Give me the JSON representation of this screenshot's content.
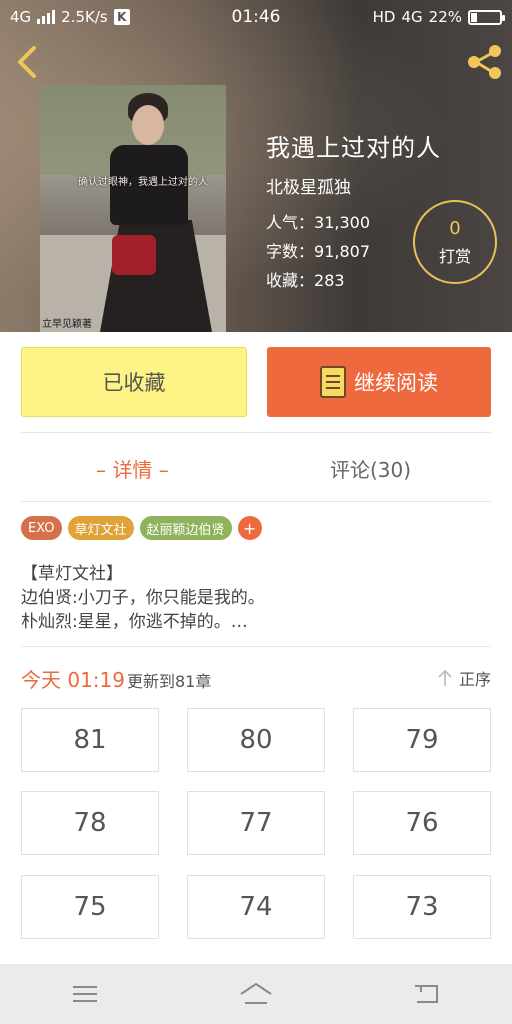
{
  "status_bar": {
    "network": "4G",
    "speed": "2.5K/s",
    "app_badge": "K",
    "time": "01:46",
    "hd": "HD",
    "network_right": "4G",
    "battery": "22%",
    "battery_level": 0.22
  },
  "header_icons": [
    "back-arrow-icon",
    "share-icon"
  ],
  "book": {
    "cover_overlay_text": "确认过眼神，我遇上过对的人",
    "cover_stamp": "立早见颖著",
    "title": "我遇上过对的人",
    "author": "北极星孤独",
    "popularity_label": "人气：",
    "popularity": "31,300",
    "word_count_label": "字数：",
    "word_count": "91,807",
    "favorites_label": "收藏：",
    "favorites": "283"
  },
  "reward": {
    "count": "0",
    "label": "打赏"
  },
  "actions": {
    "collected_label": "已收藏",
    "continue_label": "继续阅读"
  },
  "tabs": {
    "details": "– 详情 –",
    "comments": "评论(30)"
  },
  "tags": [
    "EXO",
    "草灯文社",
    "赵丽颖边伯贤",
    "+"
  ],
  "description": {
    "line1": "【草灯文社】",
    "line2": "边伯贤:小刀子，你只能是我的。",
    "line3": "朴灿烈:星星，你逃不掉的。…"
  },
  "update": {
    "time": "今天 01:19",
    "text": "更新到81章",
    "sort_label": "正序"
  },
  "chapters": [
    "81",
    "80",
    "79",
    "78",
    "77",
    "76",
    "75",
    "74",
    "73"
  ],
  "colors": {
    "accent": "#ee6a3e",
    "collected_bg": "#fdf485",
    "reward_ring": "#e8c15a"
  }
}
